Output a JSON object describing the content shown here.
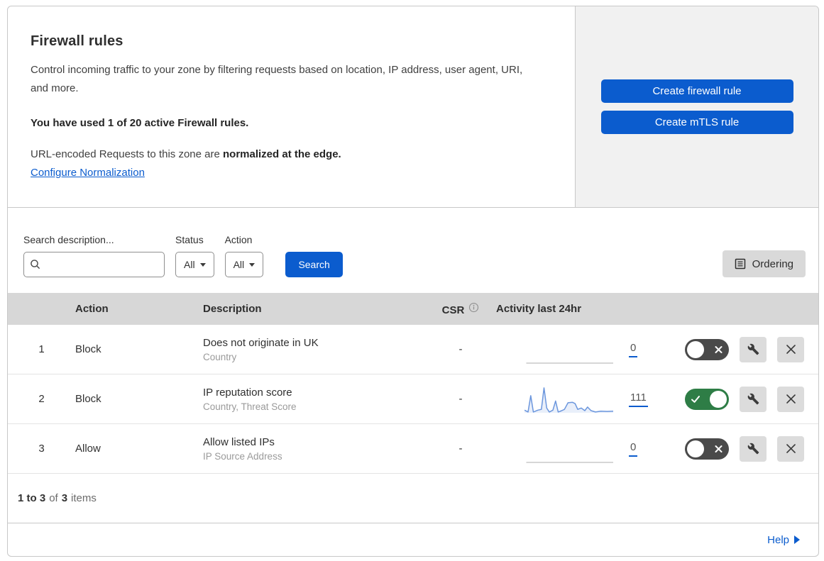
{
  "header": {
    "title": "Firewall rules",
    "description": "Control incoming traffic to your zone by filtering requests based on location, IP address, user agent, URI, and more.",
    "usage_notice": "You have used 1 of 20 active Firewall rules.",
    "normalization_text": "URL-encoded Requests to this zone are",
    "normalization_bold": "normalized at the edge.",
    "normalization_link": "Configure Normalization",
    "create_firewall_rule_label": "Create firewall rule",
    "create_mtls_rule_label": "Create mTLS rule"
  },
  "filters": {
    "search_label": "Search description...",
    "search_value": "",
    "status_label": "Status",
    "status_value": "All",
    "action_label": "Action",
    "action_value": "All",
    "search_button_label": "Search",
    "ordering_button_label": "Ordering"
  },
  "table": {
    "columns": {
      "action": "Action",
      "description": "Description",
      "csr": "CSR",
      "activity": "Activity last 24hr"
    },
    "rows": [
      {
        "num": "1",
        "action": "Block",
        "description": "Does not originate in UK",
        "fields": "Country",
        "csr": "-",
        "activity_count": "0",
        "enabled": false
      },
      {
        "num": "2",
        "action": "Block",
        "description": "IP reputation score",
        "fields": "Country, Threat Score",
        "csr": "-",
        "activity_count": "111",
        "enabled": true
      },
      {
        "num": "3",
        "action": "Allow",
        "description": "Allow listed IPs",
        "fields": "IP Source Address",
        "csr": "-",
        "activity_count": "0",
        "enabled": false
      }
    ]
  },
  "footer": {
    "range": "1 to 3",
    "of_label": "of",
    "total": "3",
    "items_label": "items",
    "help_label": "Help"
  },
  "colors": {
    "accent_blue": "#0b5cce",
    "toggle_on_green": "#2e7d46",
    "toggle_off_gray": "#4a4a4a",
    "spark_blue": "#6b96dd",
    "table_header_gray": "#d7d7d7",
    "cta_panel_gray": "#f1f1f1"
  },
  "chart_data": {
    "type": "line",
    "title": "Activity last 24hr",
    "x_range": "last 24 hours",
    "note": "sparklines per firewall rule; y = request hits (relative 0-100), totals shown beside each sparkline",
    "series": [
      {
        "name": "Does not originate in UK",
        "total": 0,
        "points": [
          [
            2,
            0
          ],
          [
            100,
            0
          ]
        ]
      },
      {
        "name": "IP reputation score",
        "total": 111,
        "points": [
          [
            0,
            10
          ],
          [
            4,
            3
          ],
          [
            7,
            65
          ],
          [
            10,
            3
          ],
          [
            15,
            10
          ],
          [
            19,
            13
          ],
          [
            22,
            95
          ],
          [
            25,
            18
          ],
          [
            28,
            3
          ],
          [
            32,
            10
          ],
          [
            35,
            45
          ],
          [
            38,
            3
          ],
          [
            42,
            8
          ],
          [
            45,
            13
          ],
          [
            49,
            38
          ],
          [
            54,
            40
          ],
          [
            57,
            35
          ],
          [
            60,
            13
          ],
          [
            64,
            18
          ],
          [
            68,
            8
          ],
          [
            71,
            22
          ],
          [
            75,
            8
          ],
          [
            80,
            3
          ],
          [
            86,
            6
          ],
          [
            93,
            5
          ],
          [
            100,
            6
          ]
        ]
      },
      {
        "name": "Allow listed IPs",
        "total": 0,
        "points": [
          [
            2,
            0
          ],
          [
            100,
            0
          ]
        ]
      }
    ]
  }
}
